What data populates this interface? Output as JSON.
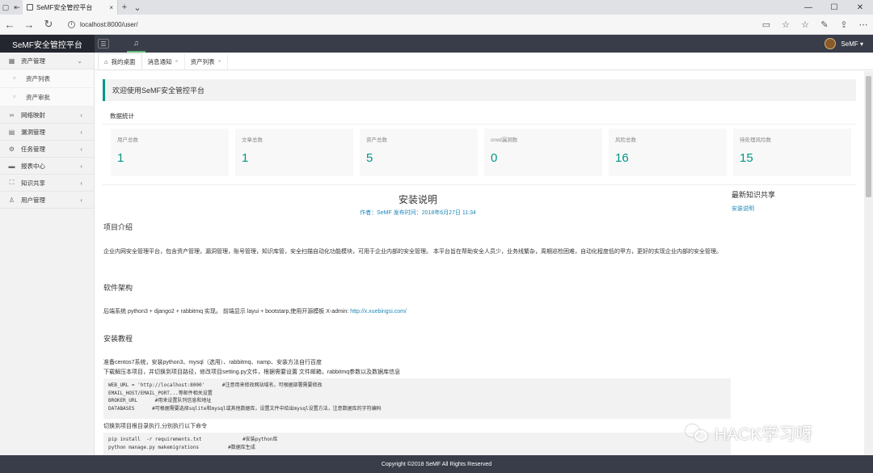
{
  "browser": {
    "tab_title": "SeMF安全管控平台",
    "url": "localhost:8000/user/"
  },
  "header": {
    "logo": "SeMF安全管控平台",
    "menu_icon": "☰",
    "bell_icon": "🔔",
    "user_name": "SeMF ▾"
  },
  "sidebar": {
    "items": [
      {
        "icon": "▦",
        "label": "资产管理",
        "arrow": "⌄"
      },
      {
        "icon": "○",
        "label": "资产列表"
      },
      {
        "icon": "○",
        "label": "资产审批"
      },
      {
        "icon": "∞",
        "label": "网络映射",
        "arrow": "‹"
      },
      {
        "icon": "▤",
        "label": "漏洞管理",
        "arrow": "‹"
      },
      {
        "icon": "⚙",
        "label": "任务管理",
        "arrow": "‹"
      },
      {
        "icon": "▬",
        "label": "报表中心",
        "arrow": "‹"
      },
      {
        "icon": "⛶",
        "label": "知识共享",
        "arrow": "‹"
      },
      {
        "icon": "♙",
        "label": "用户管理",
        "arrow": "‹"
      }
    ]
  },
  "tabs": [
    {
      "label": "我的桌面",
      "icon": "⌂"
    },
    {
      "label": "消息通知",
      "close": "×"
    },
    {
      "label": "资产列表",
      "close": "×"
    }
  ],
  "welcome": "欢迎使用SeMF安全管控平台",
  "stats_title": "数据统计",
  "stats": [
    {
      "label": "用户总数",
      "value": "1"
    },
    {
      "label": "文章总数",
      "value": "1"
    },
    {
      "label": "资产总数",
      "value": "5"
    },
    {
      "label": "cnvd漏洞数",
      "value": "0"
    },
    {
      "label": "风险总数",
      "value": "16"
    },
    {
      "label": "待处理风险数",
      "value": "15"
    }
  ],
  "article": {
    "title": "安装说明",
    "meta": "作者：SeMF 发布时间：2018年6月27日 11:34",
    "h_intro": "项目介绍",
    "intro": "企业内网安全管理平台，包含资产管理，漏洞管理，账号管理，知识库管，安全扫描自动化功能模块，可用于企业内部的安全管理。 本平台旨在帮助安全人员少，业务线繁杂，周期巡检困难，自动化程度低的甲方，更好的实现企业内部的安全管理。",
    "h_arch": "软件架构",
    "arch": "后端系统 python3 + django2 + rabbitmq 实现。 前端显示 layui + bootstarp,使用开源模板 X-admin:",
    "arch_link": "http://x.xuebingsi.com/",
    "h_install": "安装教程",
    "install_1": "准备centos7系统，安装python3、mysql（选用）、rabbitmq、namp、安装方法自行百度",
    "install_2": "下载解压本项目，并切换到项目路径，修改项目setting.py文件，根据需要设置 文件邮箱，rabbitmq参数以及数据库信息",
    "code1": "WEB_URL = 'http://localhost:8000'      #注意用来修改网站域名，可根据部署需要修改\nEMAIL_HOST/EMAIL_PORT...等邮件相关设置\nBROKER_URL      #用来设置队列信息和地址\nDATABASES      #可根据需要选择sqlite和mysql或其他数据库，设置文件中给出mysql设置方法，注意数据库的字符编码",
    "switch": "切换到项目根目录执行,分别执行以下命令",
    "code2": "pip install  -r requirements.txt              #安装python库\npython manage.py makemigrations          #数据库生成"
  },
  "side_news": {
    "title": "最新知识共享",
    "link": "安装说明"
  },
  "footer": "Copyright ©2018 SeMF All Rights Reserved",
  "watermark": "HACK学习呀",
  "colors": {
    "accent": "#009688",
    "header": "#393d49",
    "link": "#1e88b9"
  }
}
